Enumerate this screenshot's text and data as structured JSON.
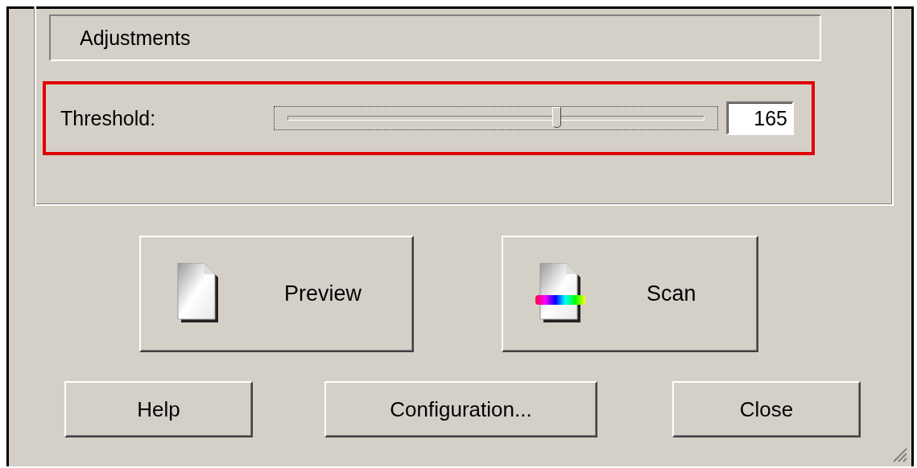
{
  "group": {
    "title": "Adjustments"
  },
  "threshold": {
    "label": "Threshold:",
    "level": 0.647,
    "value": "165",
    "highlighted": true
  },
  "large_buttons": [
    {
      "label": "Preview",
      "kind": "preview"
    },
    {
      "label": "Scan",
      "kind": "scan"
    }
  ],
  "buttons": [
    {
      "label": "Help"
    },
    {
      "label": "Configuration..."
    },
    {
      "label": "Close"
    }
  ]
}
